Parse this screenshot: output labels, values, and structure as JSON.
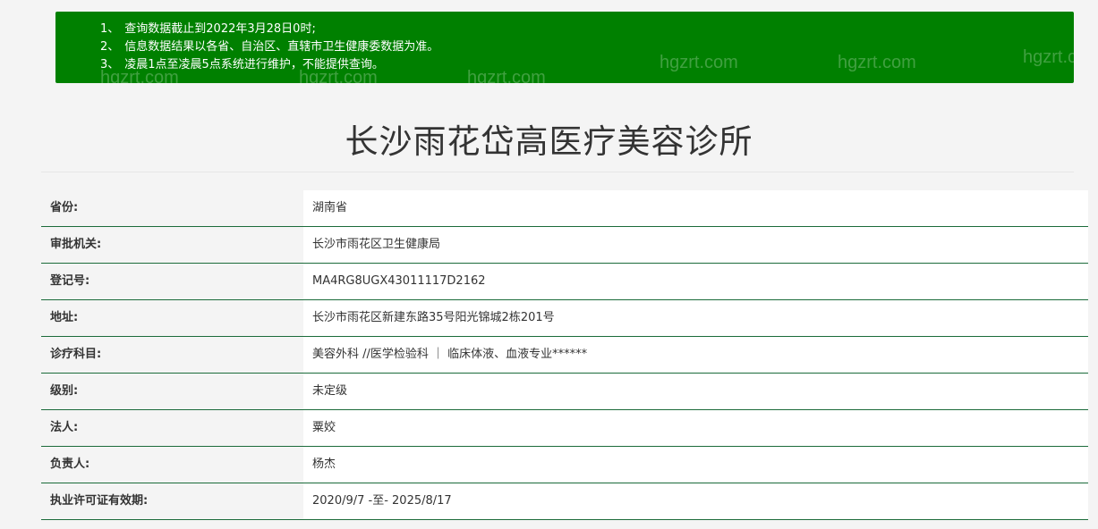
{
  "notice": {
    "lines": [
      {
        "num": "1、",
        "text": "查询数据截止到2022年3月28日0时;"
      },
      {
        "num": "2、",
        "text": "信息数据结果以各省、自治区、直辖市卫生健康委数据为准。"
      },
      {
        "num": "3、",
        "text": "凌晨1点至凌晨5点系统进行维护，不能提供查询。"
      }
    ],
    "watermark": "hgzrt.com",
    "bg_color": "#008000"
  },
  "page": {
    "title": "长沙雨花岱高医疗美容诊所"
  },
  "info": {
    "rows": [
      {
        "label": "省份:",
        "value": "湖南省"
      },
      {
        "label": "审批机关:",
        "value": "长沙市雨花区卫生健康局"
      },
      {
        "label": "登记号:",
        "value": "MA4RG8UGX43011117D2162"
      },
      {
        "label": "地址:",
        "value": "长沙市雨花区新建东路35号阳光锦城2栋201号"
      },
      {
        "label": "诊疗科目:",
        "value": "美容外科 //医学检验科 ｜ 临床体液、血液专业******"
      },
      {
        "label": "级别:",
        "value": "未定级"
      },
      {
        "label": "法人:",
        "value": "粟姣"
      },
      {
        "label": "负责人:",
        "value": "杨杰"
      },
      {
        "label": "执业许可证有效期:",
        "value": "2020/9/7 -至- 2025/8/17"
      }
    ],
    "rule_color": "#1b6b3a"
  }
}
